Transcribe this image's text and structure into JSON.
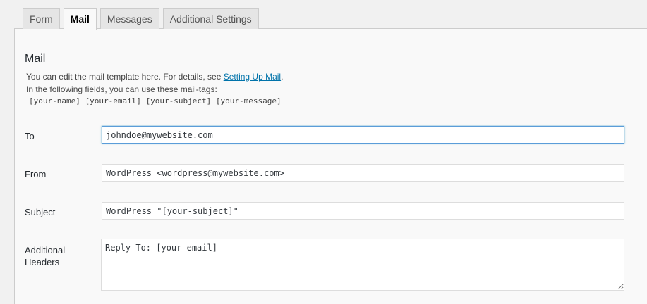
{
  "tabs": [
    {
      "label": "Form",
      "active": false
    },
    {
      "label": "Mail",
      "active": true
    },
    {
      "label": "Messages",
      "active": false
    },
    {
      "label": "Additional Settings",
      "active": false
    }
  ],
  "mail": {
    "title": "Mail",
    "description_prefix": "You can edit the mail template here. For details, see ",
    "description_link": "Setting Up Mail",
    "description_suffix": ".",
    "tags_intro": "In the following fields, you can use these mail-tags:",
    "tags": "[your-name] [your-email] [your-subject] [your-message]"
  },
  "fields": {
    "to": {
      "label": "To",
      "value": "johndoe@mywebsite.com"
    },
    "from": {
      "label": "From",
      "value": "WordPress <wordpress@mywebsite.com>"
    },
    "subject": {
      "label": "Subject",
      "value": "WordPress \"[your-subject]\""
    },
    "headers": {
      "label_line1": "Additional",
      "label_line2": "Headers",
      "value": "Reply-To: [your-email]"
    }
  },
  "colors": {
    "link": "#0073aa",
    "focus_border": "#5b9dd9",
    "panel_bg": "#f9f9f9",
    "page_bg": "#f1f1f1"
  }
}
